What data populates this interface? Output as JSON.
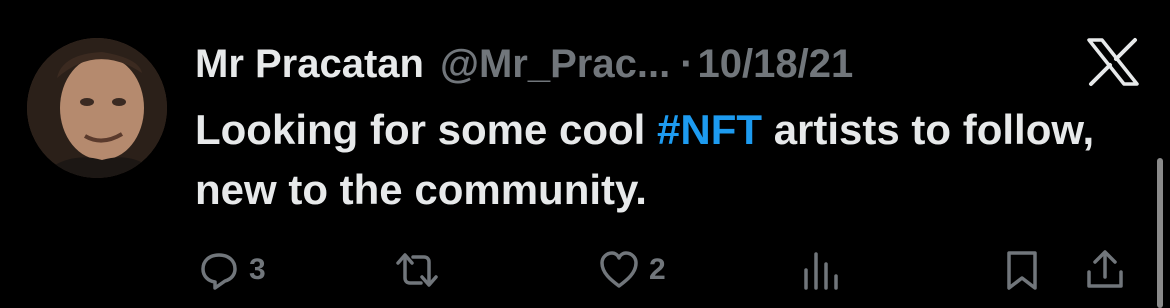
{
  "author": {
    "display_name": "Mr Pracatan",
    "handle": "@Mr_Prac...",
    "separator": "·",
    "date": "10/18/21"
  },
  "icons": {
    "avatar": "user-avatar",
    "brand": "x-logo-icon",
    "reply": "reply-icon",
    "repost": "repost-icon",
    "like": "like-icon",
    "views": "views-icon",
    "bookmark": "bookmark-icon",
    "share": "share-icon"
  },
  "tweet": {
    "text_part1": "Looking for some cool ",
    "hashtag": "#NFT",
    "text_part2": "  artists to follow, new to the community."
  },
  "actions": {
    "reply_count": "3",
    "like_count": "2"
  },
  "colors": {
    "background": "#000000",
    "text": "#e7e9ea",
    "muted": "#71767b",
    "accent": "#1d9bf0"
  }
}
